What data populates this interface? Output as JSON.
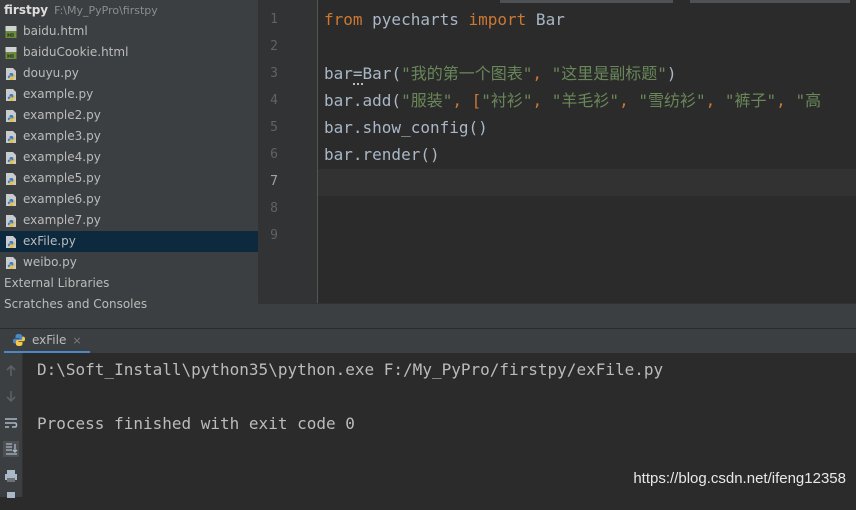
{
  "project": {
    "root_name": "firstpy",
    "root_path": "F:\\My_PyPro\\firstpy",
    "files": [
      {
        "name": "baidu.html",
        "icon": "html-file-icon"
      },
      {
        "name": "baiduCookie.html",
        "icon": "html-file-icon"
      },
      {
        "name": "douyu.py",
        "icon": "python-file-icon"
      },
      {
        "name": "example.py",
        "icon": "python-file-icon"
      },
      {
        "name": "example2.py",
        "icon": "python-file-icon"
      },
      {
        "name": "example3.py",
        "icon": "python-file-icon"
      },
      {
        "name": "example4.py",
        "icon": "python-file-icon"
      },
      {
        "name": "example5.py",
        "icon": "python-file-icon"
      },
      {
        "name": "example6.py",
        "icon": "python-file-icon"
      },
      {
        "name": "example7.py",
        "icon": "python-file-icon"
      },
      {
        "name": "exFile.py",
        "icon": "python-file-icon",
        "selected": true
      },
      {
        "name": "weibo.py",
        "icon": "python-file-icon"
      }
    ],
    "external_libraries": "External Libraries",
    "scratches": "Scratches and Consoles"
  },
  "editor": {
    "line_numbers": [
      "1",
      "2",
      "3",
      "4",
      "5",
      "6",
      "7",
      "8",
      "9"
    ],
    "current_line": "7",
    "lines": {
      "l1_kw1": "from",
      "l1_mod": " pyecharts ",
      "l1_kw2": "import",
      "l1_cls": " Bar",
      "l3_a": "bar",
      "l3_eq": "=",
      "l3_b": "Bar(",
      "l3_s1": "\"我的第一个图表\"",
      "l3_c": ", ",
      "l3_s2": "\"这里是副标题\"",
      "l3_d": ")",
      "l4_a": "bar.add(",
      "l4_s1": "\"服装\"",
      "l4_b": ", [",
      "l4_s2": "\"衬衫\"",
      "l4_c": ", ",
      "l4_s3": "\"羊毛衫\"",
      "l4_d": ", ",
      "l4_s4": "\"雪纺衫\"",
      "l4_e": ", ",
      "l4_s5": "\"裤子\"",
      "l4_f": ", ",
      "l4_s6": "\"高",
      "l5": "bar.show_config()",
      "l6": "bar.render()"
    }
  },
  "run": {
    "tab_label": "exFile",
    "close_glyph": "×",
    "console_line1": "D:\\Soft_Install\\python35\\python.exe F:/My_PyPro/firstpy/exFile.py",
    "console_line2": "Process finished with exit code 0"
  },
  "watermark": "https://blog.csdn.net/ifeng12358",
  "colors": {
    "keyword": "#cc7832",
    "string": "#6a8759",
    "selection": "#0d293e",
    "tab_underline": "#4a88c7"
  }
}
